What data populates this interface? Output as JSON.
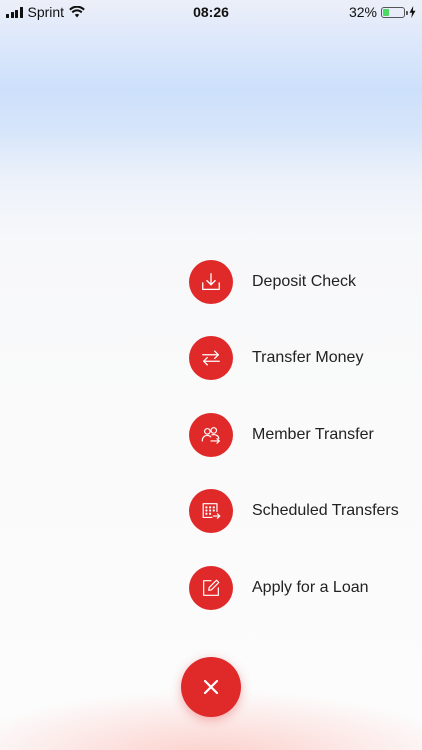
{
  "status_bar": {
    "carrier": "Sprint",
    "time": "08:26",
    "battery_percent": "32%",
    "battery_level": 0.32,
    "icons": [
      "signal-bars-icon",
      "wifi-icon",
      "battery-icon",
      "charging-bolt-icon"
    ]
  },
  "menu": {
    "items": [
      {
        "label": "Deposit Check",
        "icon": "deposit-check-icon"
      },
      {
        "label": "Transfer Money",
        "icon": "transfer-arrows-icon"
      },
      {
        "label": "Member Transfer",
        "icon": "member-transfer-icon"
      },
      {
        "label": "Scheduled Transfers",
        "icon": "scheduled-transfers-icon"
      },
      {
        "label": "Apply for a Loan",
        "icon": "apply-loan-icon"
      }
    ],
    "close_icon": "close-icon"
  },
  "colors": {
    "accent": "#e02a2a",
    "battery": "#4cd964"
  }
}
